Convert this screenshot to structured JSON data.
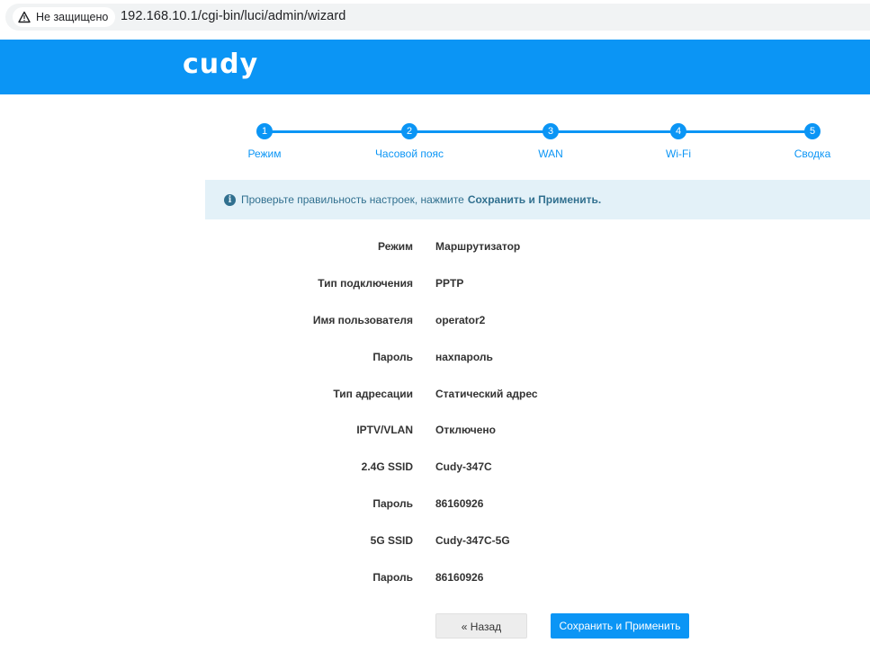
{
  "browser": {
    "security_label": "Не защищено",
    "url": "192.168.10.1/cgi-bin/luci/admin/wizard"
  },
  "header": {
    "logo": "cudy",
    "accent": "#0b95f5"
  },
  "stepper": {
    "steps": [
      {
        "num": "1",
        "label": "Режим"
      },
      {
        "num": "2",
        "label": "Часовой пояс"
      },
      {
        "num": "3",
        "label": "WAN"
      },
      {
        "num": "4",
        "label": "Wi-Fi"
      },
      {
        "num": "5",
        "label": "Сводка"
      }
    ]
  },
  "info": {
    "text": "Проверьте правильность настроек, нажмите",
    "emphasis": "Сохранить и Применить."
  },
  "summary": [
    {
      "key": "Режим",
      "value": "Маршрутизатор"
    },
    {
      "key": "Тип подключения",
      "value": "PPTP"
    },
    {
      "key": "Имя пользователя",
      "value": "operator2"
    },
    {
      "key": "Пароль",
      "value": "нахпароль"
    },
    {
      "key": "Тип адресации",
      "value": "Статический адрес"
    },
    {
      "key": "IPTV/VLAN",
      "value": "Отключено"
    },
    {
      "key": "2.4G SSID",
      "value": "Cudy-347C"
    },
    {
      "key": "Пароль",
      "value": "86160926"
    },
    {
      "key": "5G SSID",
      "value": "Cudy-347C-5G"
    },
    {
      "key": "Пароль",
      "value": "86160926"
    }
  ],
  "buttons": {
    "back": "« Назад",
    "save": "Сохранить и Применить"
  }
}
